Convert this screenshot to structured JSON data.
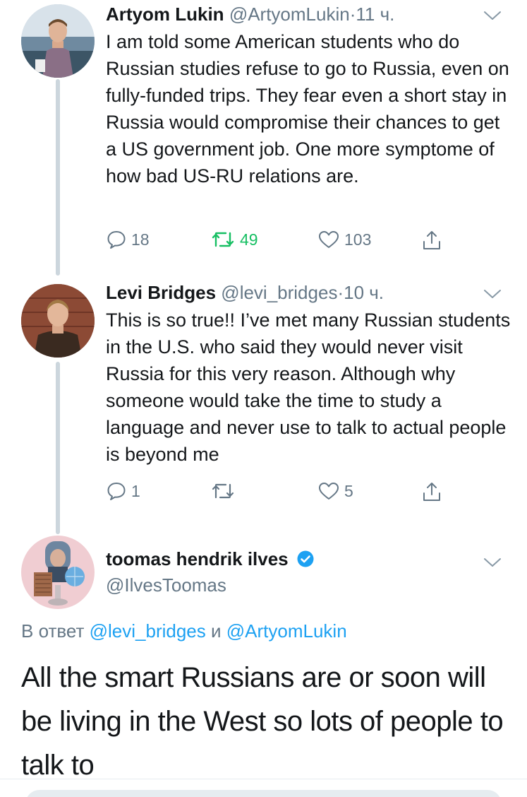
{
  "tweets": [
    {
      "name": "Artyom Lukin",
      "handle": "@ArtyomLukin",
      "time": "11 ч.",
      "text": "I am told some American students who do Russian studies refuse to go to Russia, even on fully-funded trips. They fear even a short stay in Russia would compromise their chances to get a US government job. One more symptome of how bad US-RU relations are.",
      "replies": "18",
      "retweets": "49",
      "likes": "103"
    },
    {
      "name": "Levi Bridges",
      "handle": "@levi_bridges",
      "time": "10 ч.",
      "text": "This is so true!! I’ve met many Russian students in the U.S. who said they would never visit Russia for this very reason. Although why someone would take the time to study a language and never use to talk to actual people is beyond me",
      "replies": "1",
      "retweets": "",
      "likes": "5"
    }
  ],
  "focus": {
    "name": "toomas hendrik ilves",
    "handle": "@IlvesToomas",
    "reply_prefix": "В ответ",
    "reply_user1": "@levi_bridges",
    "reply_conj": "и",
    "reply_user2": "@ArtyomLukin",
    "text": "All the smart Russians are or soon will be living in the West so lots of people to talk to"
  },
  "separator": "·",
  "icons": [
    "reply-icon",
    "retweet-icon",
    "like-icon",
    "share-icon",
    "caret-down-icon",
    "verified-badge-icon"
  ],
  "colors": {
    "link": "#1da1f2",
    "retweet_active": "#17bf63",
    "secondary": "#657786",
    "thread_line": "#ccd6dd"
  }
}
